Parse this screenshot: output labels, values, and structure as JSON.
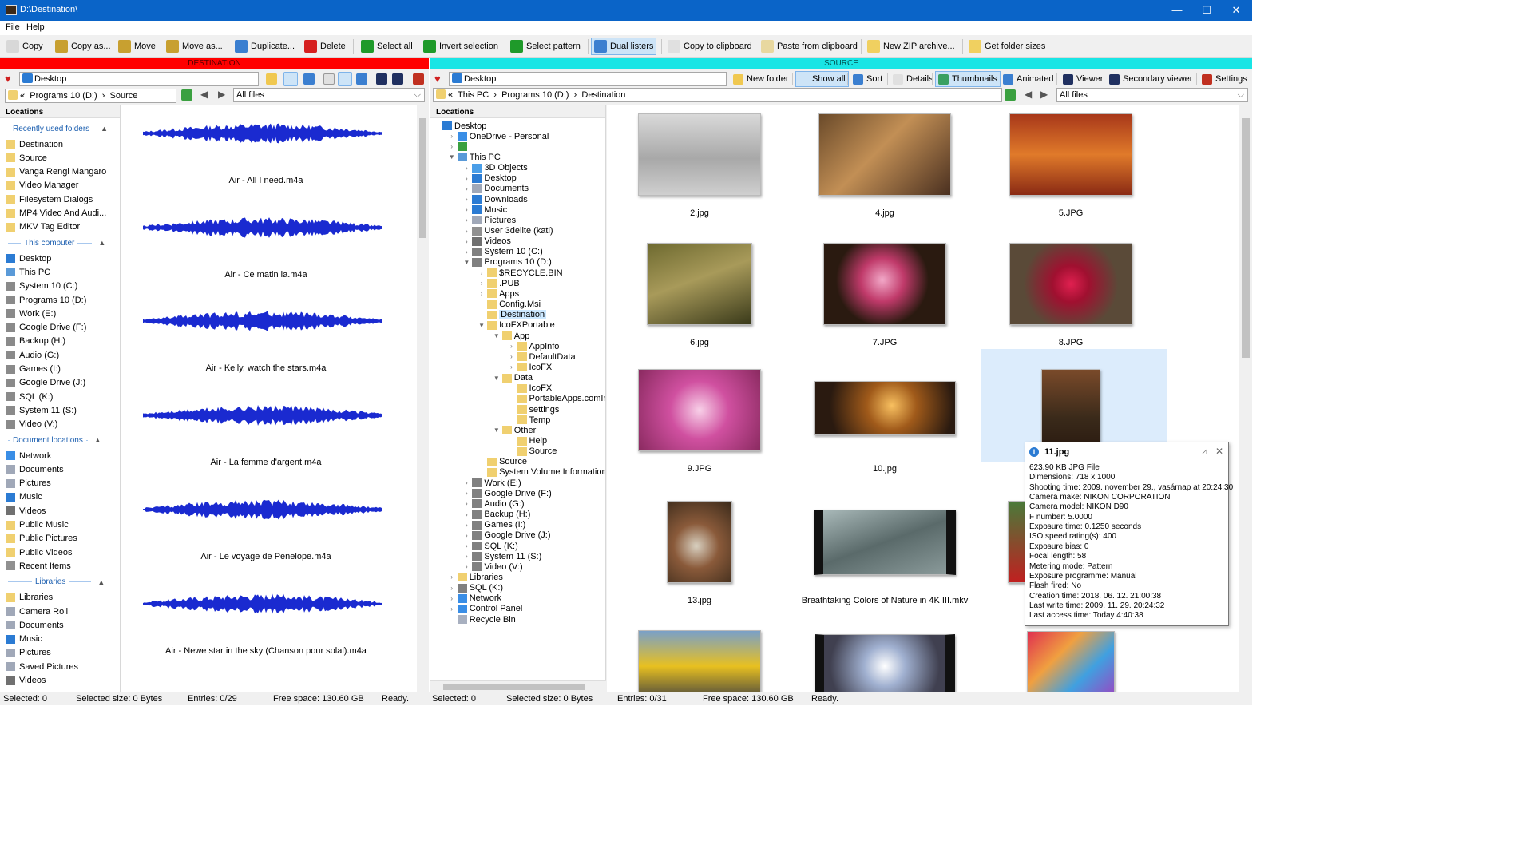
{
  "window": {
    "title": "D:\\Destination\\",
    "min": "—",
    "max": "☐",
    "close": "✕"
  },
  "menu": [
    "File",
    "Help"
  ],
  "toolbar": [
    {
      "label": "Copy",
      "icon": "copy-icon",
      "color": "#d8d8d8"
    },
    {
      "label": "Copy as...",
      "icon": "copy-as-icon",
      "color": "#c8a030"
    },
    {
      "label": "Move",
      "icon": "move-icon",
      "color": "#c8a030"
    },
    {
      "label": "Move as...",
      "icon": "move-as-icon",
      "color": "#c8a030"
    },
    {
      "label": "Duplicate...",
      "icon": "duplicate-icon",
      "color": "#3b7fd0"
    },
    {
      "label": "Delete",
      "icon": "delete-icon",
      "color": "#d62020"
    },
    {
      "label": "Select all",
      "icon": "check-icon",
      "color": "#1f9a2a"
    },
    {
      "label": "Invert selection",
      "icon": "invert-icon",
      "color": "#1f9a2a"
    },
    {
      "label": "Select pattern",
      "icon": "pattern-icon",
      "color": "#1f9a2a"
    },
    {
      "label": "Dual listers",
      "icon": "dual-listers-icon",
      "color": "#3b7fd0"
    },
    {
      "label": "Copy to clipboard",
      "icon": "clipboard-copy-icon",
      "color": "#e0e0e0"
    },
    {
      "label": "Paste from clipboard",
      "icon": "clipboard-paste-icon",
      "color": "#e8d8a0"
    },
    {
      "label": "New ZIP archive...",
      "icon": "zip-icon",
      "color": "#f0d060"
    },
    {
      "label": "Get folder sizes",
      "icon": "folder-size-icon",
      "color": "#f0d060"
    }
  ],
  "left": {
    "header": "DESTINATION",
    "path_box": "Desktop",
    "crumbs": [
      "«",
      "Programs 10 (D:)",
      "›",
      "Source"
    ],
    "filter": "All files",
    "locations_title": "Locations",
    "groups": {
      "recent": "Recently used folders",
      "computer": "This computer",
      "docs": "Document locations",
      "libs": "Libraries"
    },
    "recent": [
      "Destination",
      "Source",
      "Vanga Rengi Mangaro",
      "Video Manager",
      "Filesystem Dialogs",
      "MP4 Video And Audi...",
      "MKV Tag Editor"
    ],
    "computer": [
      "Desktop",
      "This PC",
      "System 10 (C:)",
      "Programs 10 (D:)",
      "Work (E:)",
      "Google Drive (F:)",
      "Backup (H:)",
      "Audio (G:)",
      "Games (I:)",
      "Google Drive (J:)",
      "SQL (K:)",
      "System 11 (S:)",
      "Video (V:)"
    ],
    "docs": [
      "Network",
      "Documents",
      "Pictures",
      "Music",
      "Videos",
      "Public Music",
      "Public Pictures",
      "Public Videos",
      "Recent Items"
    ],
    "libs": [
      "Libraries",
      "Camera Roll",
      "Documents",
      "Music",
      "Pictures",
      "Saved Pictures",
      "Videos"
    ],
    "files": [
      "Air - All I need.m4a",
      "Air - Ce matin la.m4a",
      "Air - Kelly, watch the stars.m4a",
      "Air - La femme d'argent.m4a",
      "Air - Le voyage de Penelope.m4a",
      "Air - Newe star in the sky (Chanson pour solal).m4a"
    ]
  },
  "right": {
    "header": "SOURCE",
    "path_box": "Desktop",
    "buttons": [
      "New folder",
      "Show all",
      "Sort",
      "Details",
      "Thumbnails",
      "Animated",
      "Viewer",
      "Secondary viewer",
      "Settings"
    ],
    "crumbs": [
      "«",
      "This PC",
      "›",
      "Programs 10 (D:)",
      "›",
      "Destination"
    ],
    "filter": "All files",
    "locations_title": "Locations",
    "tree": [
      {
        "label": "Desktop",
        "level": 0,
        "arrow": "",
        "icon": "#2b7bd3"
      },
      {
        "label": "OneDrive - Personal",
        "level": 1,
        "arrow": ">",
        "icon": "#3a8ee6"
      },
      {
        "label": "",
        "level": 1,
        "arrow": ">",
        "icon": "#3aa040"
      },
      {
        "label": "This PC",
        "level": 1,
        "arrow": "v",
        "icon": "#5a9ad8"
      },
      {
        "label": "3D Objects",
        "level": 2,
        "arrow": ">",
        "icon": "#4a9ee8"
      },
      {
        "label": "Desktop",
        "level": 2,
        "arrow": ">",
        "icon": "#2b7bd3"
      },
      {
        "label": "Documents",
        "level": 2,
        "arrow": ">",
        "icon": "#a0a8b8"
      },
      {
        "label": "Downloads",
        "level": 2,
        "arrow": ">",
        "icon": "#2b7bd3"
      },
      {
        "label": "Music",
        "level": 2,
        "arrow": ">",
        "icon": "#2b7bd3"
      },
      {
        "label": "Pictures",
        "level": 2,
        "arrow": ">",
        "icon": "#a0a8b8"
      },
      {
        "label": "User 3delite (kati)",
        "level": 2,
        "arrow": ">",
        "icon": "#909090"
      },
      {
        "label": "Videos",
        "level": 2,
        "arrow": ">",
        "icon": "#707070"
      },
      {
        "label": "System 10 (C:)",
        "level": 2,
        "arrow": ">",
        "icon": "#808080"
      },
      {
        "label": "Programs 10 (D:)",
        "level": 2,
        "arrow": "v",
        "icon": "#808080"
      },
      {
        "label": "$RECYCLE.BIN",
        "level": 3,
        "arrow": ">",
        "icon": "#f0d070"
      },
      {
        "label": ".PUB",
        "level": 3,
        "arrow": ">",
        "icon": "#f0d070"
      },
      {
        "label": "Apps",
        "level": 3,
        "arrow": ">",
        "icon": "#f0d070"
      },
      {
        "label": "Config.Msi",
        "level": 3,
        "arrow": "",
        "icon": "#f0d070"
      },
      {
        "label": "Destination",
        "level": 3,
        "arrow": "",
        "icon": "#f0d070",
        "selected": true
      },
      {
        "label": "IcoFXPortable",
        "level": 3,
        "arrow": "v",
        "icon": "#f0d070"
      },
      {
        "label": "App",
        "level": 4,
        "arrow": "v",
        "icon": "#f0d070"
      },
      {
        "label": "AppInfo",
        "level": 5,
        "arrow": ">",
        "icon": "#f0d070"
      },
      {
        "label": "DefaultData",
        "level": 5,
        "arrow": ">",
        "icon": "#f0d070"
      },
      {
        "label": "IcoFX",
        "level": 5,
        "arrow": ">",
        "icon": "#f0d070"
      },
      {
        "label": "Data",
        "level": 4,
        "arrow": "v",
        "icon": "#f0d070"
      },
      {
        "label": "IcoFX",
        "level": 5,
        "arrow": "",
        "icon": "#f0d070"
      },
      {
        "label": "PortableApps.comInsta",
        "level": 5,
        "arrow": "",
        "icon": "#f0d070"
      },
      {
        "label": "settings",
        "level": 5,
        "arrow": "",
        "icon": "#f0d070"
      },
      {
        "label": "Temp",
        "level": 5,
        "arrow": "",
        "icon": "#f0d070"
      },
      {
        "label": "Other",
        "level": 4,
        "arrow": "v",
        "icon": "#f0d070"
      },
      {
        "label": "Help",
        "level": 5,
        "arrow": "",
        "icon": "#f0d070"
      },
      {
        "label": "Source",
        "level": 5,
        "arrow": "",
        "icon": "#f0d070"
      },
      {
        "label": "Source",
        "level": 3,
        "arrow": "",
        "icon": "#f0d070"
      },
      {
        "label": "System Volume Information",
        "level": 3,
        "arrow": "",
        "icon": "#f0d070"
      },
      {
        "label": "Work (E:)",
        "level": 2,
        "arrow": ">",
        "icon": "#808080"
      },
      {
        "label": "Google Drive (F:)",
        "level": 2,
        "arrow": ">",
        "icon": "#808080"
      },
      {
        "label": "Audio (G:)",
        "level": 2,
        "arrow": ">",
        "icon": "#808080"
      },
      {
        "label": "Backup (H:)",
        "level": 2,
        "arrow": ">",
        "icon": "#808080"
      },
      {
        "label": "Games (I:)",
        "level": 2,
        "arrow": ">",
        "icon": "#808080"
      },
      {
        "label": "Google Drive (J:)",
        "level": 2,
        "arrow": ">",
        "icon": "#808080"
      },
      {
        "label": "SQL (K:)",
        "level": 2,
        "arrow": ">",
        "icon": "#808080"
      },
      {
        "label": "System 11 (S:)",
        "level": 2,
        "arrow": ">",
        "icon": "#808080"
      },
      {
        "label": "Video (V:)",
        "level": 2,
        "arrow": ">",
        "icon": "#808080"
      },
      {
        "label": "Libraries",
        "level": 1,
        "arrow": ">",
        "icon": "#f0d070"
      },
      {
        "label": "SQL (K:)",
        "level": 1,
        "arrow": ">",
        "icon": "#808080"
      },
      {
        "label": "Network",
        "level": 1,
        "arrow": ">",
        "icon": "#3a8ee6"
      },
      {
        "label": "Control Panel",
        "level": 1,
        "arrow": ">",
        "icon": "#3a8ee6"
      },
      {
        "label": "Recycle Bin",
        "level": 1,
        "arrow": "",
        "icon": "#a8b0c0"
      }
    ],
    "thumbs": [
      {
        "name": "2.jpg",
        "bg": "linear-gradient(180deg,#d9d9d9 0%,#a8a8a8 55%,#cfcfcf 100%)"
      },
      {
        "name": "4.jpg",
        "bg": "linear-gradient(135deg,#6a4a2a 0%,#c28f55 45%,#4a3020 100%)"
      },
      {
        "name": "5.JPG",
        "bg": "linear-gradient(180deg,#a8381a 0%,#e07a2a 50%,#8a2a14 100%)"
      },
      {
        "name": "6.jpg",
        "bg": "linear-gradient(160deg,#6e6a30 0%,#a89a5a 45%,#3a3a1a 100%)"
      },
      {
        "name": "7.JPG",
        "bg": "radial-gradient(circle at 48% 45%,#f2a8c8 0%,#c03a6a 28%,#2a1a10 60%)"
      },
      {
        "name": "8.JPG",
        "bg": "radial-gradient(circle at 50% 50%,#e02050 0%,#a01030 25%,#5a4a38 65%)"
      },
      {
        "name": "9.JPG",
        "bg": "radial-gradient(circle at 50% 50%,#f8d0e8 0%,#d050a0 40%,#8a2a60 100%)"
      },
      {
        "name": "10.jpg",
        "bg": "radial-gradient(circle at 55% 45%,#f8c060 0%,#a05a1a 30%,#2a1a10 75%)"
      },
      {
        "name": "11.jpg",
        "bg": "linear-gradient(180deg,#7a4a2a 0%,#3a2a1a 60%,#2a1a10 100%)"
      },
      {
        "name": "13.jpg",
        "bg": "radial-gradient(circle at 45% 55%,#d8d0c0 0%,#8a5a3a 40%,#3a2a1a 100%)"
      },
      {
        "name": "Breathtaking Colors of Nature in 4K III.mkv",
        "bg": "linear-gradient(160deg,#a8b8b8 0%,#5a6a6a 50%,#8a9a9a 100%)"
      },
      {
        "name": "",
        "bg": "linear-gradient(180deg,#4a7a3a 0%,#c02020 100%)"
      },
      {
        "name": "",
        "bg": "linear-gradient(180deg,#7aa0c8 0%,#e8c020 50%,#404040 100%)"
      },
      {
        "name": "",
        "bg": "radial-gradient(circle at 50% 50%,#ffffff 0%,#a0b0d0 30%,#404050 80%)"
      },
      {
        "name": "",
        "bg": "linear-gradient(135deg,#e03050 0%,#f0a040 35%,#40a0e0 65%,#a040c0 100%)"
      }
    ]
  },
  "tooltip": {
    "title": "11.jpg",
    "lines": [
      "623.90 KB JPG File",
      "Dimensions: 718 x 1000",
      "Shooting time: 2009. november 29., vasárnap at 20:24:30",
      "Camera make: NIKON CORPORATION",
      "Camera model: NIKON D90",
      "F number: 5.0000",
      "Exposure time: 0.1250 seconds",
      "ISO speed rating(s): 400",
      "Exposure bias: 0",
      "Focal length: 58",
      "Metering mode: Pattern",
      "Exposure programme: Manual",
      "Flash fired: No",
      "Creation time:    2018. 06. 12. 21:00:38",
      "Last write time:  2009. 11. 29. 20:24:32",
      "Last access time: Today 4:40:38"
    ]
  },
  "status": {
    "left": [
      "Selected: 0",
      "Selected size: 0 Bytes",
      "Entries: 0/29",
      "Free space: 130.60 GB",
      "Ready."
    ],
    "right": [
      "Selected: 0",
      "Selected size: 0 Bytes",
      "Entries: 0/31",
      "Free space: 130.60 GB",
      "Ready."
    ]
  },
  "colors": {
    "dest": "#ff0000",
    "source": "#19e5e5",
    "titlebar": "#0a64c8",
    "wave": "#1a2ad0"
  }
}
